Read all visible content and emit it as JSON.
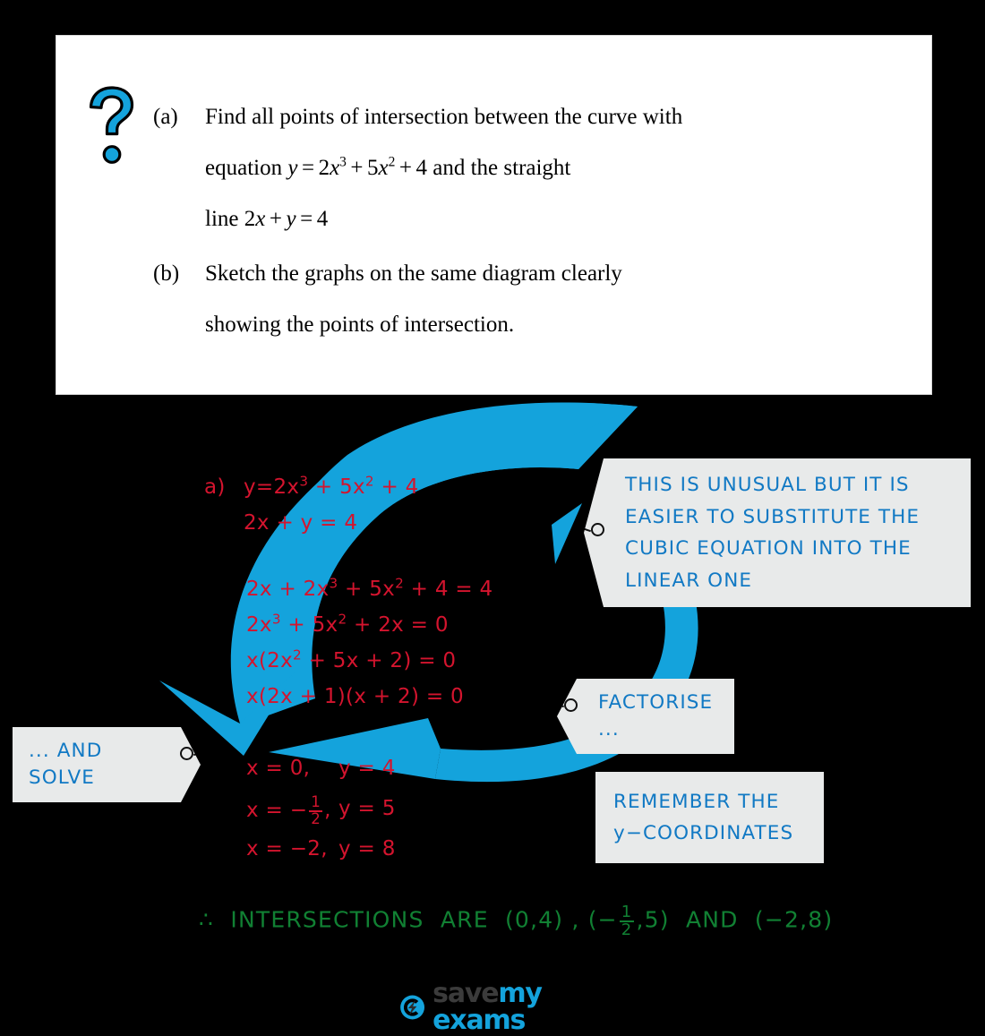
{
  "question": {
    "icon": "question-mark-icon",
    "parts": [
      {
        "label": "(a)",
        "lines": [
          "Find all points of intersection between the curve with",
          "equation y = 2x^3 + 5x^2 + 4 and the straight",
          "line 2x + y = 4"
        ]
      },
      {
        "label": "(b)",
        "lines": [
          "Sketch the graphs on the same diagram clearly",
          "showing the points of intersection."
        ]
      }
    ]
  },
  "working": {
    "part_label": "a)",
    "lines": [
      "y=2x³ + 5x² + 4",
      "2x + y = 4",
      "2x + 2x³ + 5x² + 4 = 4",
      "2x³ + 5x² + 2x = 0",
      "x(2x² + 5x + 2) = 0",
      "x(2x + 1)(x + 2) = 0"
    ],
    "solutions": [
      {
        "x": "x = 0,",
        "y": "y = 4"
      },
      {
        "x_pre": "x = −",
        "x_num": "1",
        "x_den": "2",
        "x_post": ",",
        "y": "y = 5"
      },
      {
        "x": "x = −2,",
        "y": "y = 8"
      }
    ]
  },
  "callouts": {
    "unusual": "THIS IS UNUSUAL  BUT  IT IS\nEASIER  TO  SUBSTITUTE  THE\nCUBIC  EQUATION  INTO  THE\nLINEAR  ONE",
    "factorise": "FACTORISE ...",
    "solve": "... AND  SOLVE",
    "remember": "REMEMBER  THE\ny−COORDINATES"
  },
  "conclusion": {
    "symbol": "∴",
    "pre": "INTERSECTIONS   ARE  (0,4) , (−",
    "frac_num": "1",
    "frac_den": "2",
    "post": ",5)  AND  (−2,8)"
  },
  "logo": {
    "word1": "save",
    "word2": "my exams",
    "icon": "lightning-bolt-circle-icon"
  },
  "colors": {
    "arrow_blue": "#14a3dc",
    "callout_text_blue": "#1179c4",
    "work_red": "#d4142e",
    "conclusion_green": "#118033",
    "card_background": "#ffffff",
    "page_background": "#000000",
    "tag_background": "#e8eaea"
  }
}
